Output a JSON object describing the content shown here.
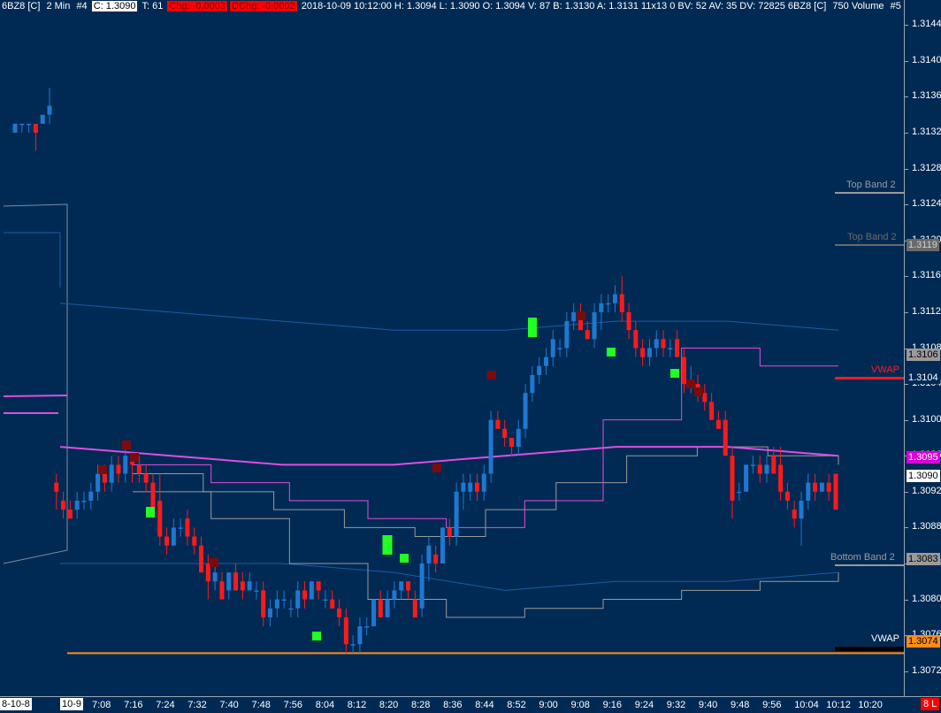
{
  "header": {
    "symbol": "6BZ8 [C]",
    "interval": "2 Min",
    "chart_no": "#4",
    "close": "C: 1.3090",
    "ticks": "T: 61",
    "chg": "Chg: -0.0003",
    "dchg": "DChg: -0.0002",
    "detail": "2018-10-09 10:12:00 H: 1.3094 L: 1.3090 O: 1.3094 V: 87 B: 1.3130 A: 1.3131 11x13 0 BV: 52 AV: 35 DV: 72825 6BZ8 [C]",
    "volume_label": "750 Volume",
    "volume_no": "#5"
  },
  "colors": {
    "background": "#002a54",
    "up_candle": "#1f78d0",
    "down_candle": "#ff1a1a",
    "green_marker": "#22ff22",
    "darkred_marker": "#7a0c0c",
    "vwap_line": "#e04de0",
    "band_gray": "#9a9a9a",
    "band_blue": "#1e5aa6",
    "support_line": "#ff8c1a",
    "vwap_tag": "#ff1a1a"
  },
  "tags": {
    "top_band_2a": "Top Band 2",
    "top_band_2b": "Top Band 2",
    "top_band_2b_value": "1.3119",
    "upper_value": "1.3106",
    "vwap_red_label": "VWAP",
    "vwap_red_value": "1.3104",
    "magenta_value": "1.3095",
    "last_value": "1.3090",
    "bottom_band_2": "Bottom Band 2",
    "bottom_band_2_value": "1.3083",
    "vwap_black_label": "VWAP",
    "vwap_black_value": "1.3074"
  },
  "time_axis": {
    "date_start": "8-10-8",
    "date_mid": "10-9",
    "corner_tag": "8 L"
  },
  "chart_data": {
    "type": "candlestick",
    "ylim": [
      1.307,
      1.3146
    ],
    "y_ticks": [
      "1.3072",
      "1.3076",
      "1.3080",
      "1.3084",
      "1.3088",
      "1.3092",
      "1.3096",
      "1.3100",
      "1.3104",
      "1.3108",
      "1.3112",
      "1.3116",
      "1.3120",
      "1.3124",
      "1.3128",
      "1.3132",
      "1.3136",
      "1.3140",
      "1.3144"
    ],
    "x_ticks": [
      "7:08",
      "7:16",
      "7:24",
      "7:32",
      "7:40",
      "7:48",
      "7:56",
      "8:04",
      "8:12",
      "8:20",
      "8:28",
      "8:36",
      "8:44",
      "8:52",
      "9:00",
      "9:08",
      "9:16",
      "9:24",
      "9:32",
      "9:40",
      "9:48",
      "9:56",
      "10:04",
      "10:12",
      "10:20"
    ],
    "candles": [
      {
        "o": 1.3132,
        "h": 1.3133,
        "l": 1.3132,
        "c": 1.3133
      },
      {
        "o": 1.3133,
        "h": 1.3133,
        "l": 1.3132,
        "c": 1.3133
      },
      {
        "o": 1.3133,
        "h": 1.3133,
        "l": 1.3132,
        "c": 1.3133
      },
      {
        "o": 1.3133,
        "h": 1.3133,
        "l": 1.313,
        "c": 1.3132
      },
      {
        "o": 1.3133,
        "h": 1.3134,
        "l": 1.3133,
        "c": 1.3134
      },
      {
        "o": 1.3134,
        "h": 1.3137,
        "l": 1.3133,
        "c": 1.3135
      },
      {
        "o": 1.3093,
        "h": 1.3094,
        "l": 1.309,
        "c": 1.3092
      },
      {
        "o": 1.3091,
        "h": 1.3092,
        "l": 1.3089,
        "c": 1.309
      },
      {
        "o": 1.309,
        "h": 1.3091,
        "l": 1.3089,
        "c": 1.3089
      },
      {
        "o": 1.309,
        "h": 1.3092,
        "l": 1.3089,
        "c": 1.3091
      },
      {
        "o": 1.3091,
        "h": 1.3092,
        "l": 1.309,
        "c": 1.3091
      },
      {
        "o": 1.3091,
        "h": 1.3093,
        "l": 1.309,
        "c": 1.3092
      },
      {
        "o": 1.3092,
        "h": 1.3095,
        "l": 1.3091,
        "c": 1.3094
      },
      {
        "o": 1.3094,
        "h": 1.3095,
        "l": 1.3092,
        "c": 1.3093
      },
      {
        "o": 1.3093,
        "h": 1.3096,
        "l": 1.3092,
        "c": 1.3095
      },
      {
        "o": 1.3095,
        "h": 1.3096,
        "l": 1.3093,
        "c": 1.3094
      },
      {
        "o": 1.3094,
        "h": 1.3097,
        "l": 1.3093,
        "c": 1.3096
      },
      {
        "o": 1.3096,
        "h": 1.3096,
        "l": 1.3093,
        "c": 1.3095
      },
      {
        "o": 1.3095,
        "h": 1.3096,
        "l": 1.3093,
        "c": 1.3094
      },
      {
        "o": 1.3094,
        "h": 1.3095,
        "l": 1.3092,
        "c": 1.3093
      },
      {
        "o": 1.3093,
        "h": 1.3094,
        "l": 1.3089,
        "c": 1.309
      },
      {
        "o": 1.3091,
        "h": 1.3094,
        "l": 1.3086,
        "c": 1.3087
      },
      {
        "o": 1.3087,
        "h": 1.3088,
        "l": 1.3085,
        "c": 1.3086
      },
      {
        "o": 1.3086,
        "h": 1.3089,
        "l": 1.3086,
        "c": 1.3088
      },
      {
        "o": 1.3088,
        "h": 1.3089,
        "l": 1.3087,
        "c": 1.3088
      },
      {
        "o": 1.3089,
        "h": 1.309,
        "l": 1.3086,
        "c": 1.3087
      },
      {
        "o": 1.3087,
        "h": 1.3088,
        "l": 1.3085,
        "c": 1.3086
      },
      {
        "o": 1.3086,
        "h": 1.3087,
        "l": 1.3083,
        "c": 1.3083
      },
      {
        "o": 1.3084,
        "h": 1.3085,
        "l": 1.308,
        "c": 1.3082
      },
      {
        "o": 1.3082,
        "h": 1.3084,
        "l": 1.3081,
        "c": 1.3083
      },
      {
        "o": 1.3082,
        "h": 1.3083,
        "l": 1.308,
        "c": 1.308
      },
      {
        "o": 1.3081,
        "h": 1.3083,
        "l": 1.308,
        "c": 1.3083
      },
      {
        "o": 1.3083,
        "h": 1.3084,
        "l": 1.3081,
        "c": 1.3081
      },
      {
        "o": 1.3082,
        "h": 1.3083,
        "l": 1.308,
        "c": 1.3081
      },
      {
        "o": 1.3081,
        "h": 1.3083,
        "l": 1.3081,
        "c": 1.3082
      },
      {
        "o": 1.3081,
        "h": 1.3082,
        "l": 1.308,
        "c": 1.3081
      },
      {
        "o": 1.3081,
        "h": 1.3082,
        "l": 1.3077,
        "c": 1.3078
      },
      {
        "o": 1.3078,
        "h": 1.308,
        "l": 1.3077,
        "c": 1.3079
      },
      {
        "o": 1.3079,
        "h": 1.3081,
        "l": 1.3078,
        "c": 1.308
      },
      {
        "o": 1.308,
        "h": 1.3081,
        "l": 1.3079,
        "c": 1.308
      },
      {
        "o": 1.3079,
        "h": 1.308,
        "l": 1.3078,
        "c": 1.3079
      },
      {
        "o": 1.3079,
        "h": 1.3082,
        "l": 1.3078,
        "c": 1.3081
      },
      {
        "o": 1.3081,
        "h": 1.3082,
        "l": 1.3079,
        "c": 1.308
      },
      {
        "o": 1.308,
        "h": 1.3082,
        "l": 1.308,
        "c": 1.3082
      },
      {
        "o": 1.3082,
        "h": 1.3082,
        "l": 1.308,
        "c": 1.3081
      },
      {
        "o": 1.308,
        "h": 1.3081,
        "l": 1.3079,
        "c": 1.308
      },
      {
        "o": 1.308,
        "h": 1.3081,
        "l": 1.3079,
        "c": 1.3079
      },
      {
        "o": 1.3079,
        "h": 1.308,
        "l": 1.3077,
        "c": 1.3078
      },
      {
        "o": 1.3078,
        "h": 1.3079,
        "l": 1.3074,
        "c": 1.3075
      },
      {
        "o": 1.3075,
        "h": 1.3076,
        "l": 1.3074,
        "c": 1.3075
      },
      {
        "o": 1.3075,
        "h": 1.3078,
        "l": 1.3074,
        "c": 1.3077
      },
      {
        "o": 1.3077,
        "h": 1.3078,
        "l": 1.3076,
        "c": 1.3077
      },
      {
        "o": 1.3077,
        "h": 1.308,
        "l": 1.3077,
        "c": 1.308
      },
      {
        "o": 1.308,
        "h": 1.3081,
        "l": 1.3078,
        "c": 1.3078
      },
      {
        "o": 1.3078,
        "h": 1.3081,
        "l": 1.3078,
        "c": 1.308
      },
      {
        "o": 1.308,
        "h": 1.3082,
        "l": 1.3079,
        "c": 1.3081
      },
      {
        "o": 1.3081,
        "h": 1.3082,
        "l": 1.308,
        "c": 1.3082
      },
      {
        "o": 1.3082,
        "h": 1.3082,
        "l": 1.308,
        "c": 1.3081
      },
      {
        "o": 1.308,
        "h": 1.3081,
        "l": 1.3078,
        "c": 1.3078
      },
      {
        "o": 1.3079,
        "h": 1.3085,
        "l": 1.3078,
        "c": 1.3084
      },
      {
        "o": 1.3084,
        "h": 1.3087,
        "l": 1.3082,
        "c": 1.3086
      },
      {
        "o": 1.3085,
        "h": 1.3086,
        "l": 1.3083,
        "c": 1.3084
      },
      {
        "o": 1.3084,
        "h": 1.3088,
        "l": 1.3084,
        "c": 1.3088
      },
      {
        "o": 1.3088,
        "h": 1.3089,
        "l": 1.3086,
        "c": 1.3087
      },
      {
        "o": 1.3087,
        "h": 1.3093,
        "l": 1.3086,
        "c": 1.3092
      },
      {
        "o": 1.3092,
        "h": 1.3094,
        "l": 1.309,
        "c": 1.3093
      },
      {
        "o": 1.3092,
        "h": 1.3094,
        "l": 1.3091,
        "c": 1.3093
      },
      {
        "o": 1.3093,
        "h": 1.3094,
        "l": 1.3091,
        "c": 1.3092
      },
      {
        "o": 1.3092,
        "h": 1.3095,
        "l": 1.3091,
        "c": 1.3094
      },
      {
        "o": 1.3094,
        "h": 1.3101,
        "l": 1.3093,
        "c": 1.31
      },
      {
        "o": 1.31,
        "h": 1.3101,
        "l": 1.3099,
        "c": 1.3099
      },
      {
        "o": 1.3099,
        "h": 1.31,
        "l": 1.3097,
        "c": 1.3098
      },
      {
        "o": 1.3098,
        "h": 1.3098,
        "l": 1.3096,
        "c": 1.3097
      },
      {
        "o": 1.3097,
        "h": 1.31,
        "l": 1.3096,
        "c": 1.3099
      },
      {
        "o": 1.3099,
        "h": 1.3104,
        "l": 1.3098,
        "c": 1.3103
      },
      {
        "o": 1.3103,
        "h": 1.3106,
        "l": 1.3102,
        "c": 1.3105
      },
      {
        "o": 1.3105,
        "h": 1.3107,
        "l": 1.3104,
        "c": 1.3106
      },
      {
        "o": 1.3106,
        "h": 1.3108,
        "l": 1.3105,
        "c": 1.3107
      },
      {
        "o": 1.3107,
        "h": 1.311,
        "l": 1.3106,
        "c": 1.3109
      },
      {
        "o": 1.3108,
        "h": 1.3109,
        "l": 1.3107,
        "c": 1.3108
      },
      {
        "o": 1.3108,
        "h": 1.3112,
        "l": 1.3107,
        "c": 1.3111
      },
      {
        "o": 1.3111,
        "h": 1.3113,
        "l": 1.311,
        "c": 1.3112
      },
      {
        "o": 1.3112,
        "h": 1.3113,
        "l": 1.311,
        "c": 1.311
      },
      {
        "o": 1.311,
        "h": 1.3111,
        "l": 1.3109,
        "c": 1.3109
      },
      {
        "o": 1.3109,
        "h": 1.3113,
        "l": 1.3108,
        "c": 1.3112
      },
      {
        "o": 1.3112,
        "h": 1.3114,
        "l": 1.311,
        "c": 1.3113
      },
      {
        "o": 1.3113,
        "h": 1.3114,
        "l": 1.3112,
        "c": 1.3113
      },
      {
        "o": 1.3113,
        "h": 1.3115,
        "l": 1.3112,
        "c": 1.3114
      },
      {
        "o": 1.3114,
        "h": 1.3116,
        "l": 1.3111,
        "c": 1.3112
      },
      {
        "o": 1.3112,
        "h": 1.3113,
        "l": 1.3109,
        "c": 1.311
      },
      {
        "o": 1.311,
        "h": 1.3111,
        "l": 1.3107,
        "c": 1.3108
      },
      {
        "o": 1.3108,
        "h": 1.3109,
        "l": 1.3106,
        "c": 1.3107
      },
      {
        "o": 1.3107,
        "h": 1.3109,
        "l": 1.3106,
        "c": 1.3108
      },
      {
        "o": 1.3108,
        "h": 1.311,
        "l": 1.3107,
        "c": 1.3109
      },
      {
        "o": 1.3109,
        "h": 1.311,
        "l": 1.3107,
        "c": 1.3108
      },
      {
        "o": 1.3108,
        "h": 1.3109,
        "l": 1.3107,
        "c": 1.3108
      },
      {
        "o": 1.3109,
        "h": 1.311,
        "l": 1.3107,
        "c": 1.3107
      },
      {
        "o": 1.3107,
        "h": 1.3108,
        "l": 1.3103,
        "c": 1.3104
      },
      {
        "o": 1.3104,
        "h": 1.3106,
        "l": 1.3103,
        "c": 1.3104
      },
      {
        "o": 1.3104,
        "h": 1.3105,
        "l": 1.3102,
        "c": 1.3103
      },
      {
        "o": 1.3103,
        "h": 1.3104,
        "l": 1.3101,
        "c": 1.3102
      },
      {
        "o": 1.3102,
        "h": 1.3103,
        "l": 1.31,
        "c": 1.31
      },
      {
        "o": 1.31,
        "h": 1.3101,
        "l": 1.3099,
        "c": 1.3099
      },
      {
        "o": 1.31,
        "h": 1.3101,
        "l": 1.3096,
        "c": 1.3096
      },
      {
        "o": 1.3096,
        "h": 1.3097,
        "l": 1.3089,
        "c": 1.3091
      },
      {
        "o": 1.3092,
        "h": 1.3093,
        "l": 1.3091,
        "c": 1.3092
      },
      {
        "o": 1.3092,
        "h": 1.3095,
        "l": 1.3092,
        "c": 1.3095
      },
      {
        "o": 1.3095,
        "h": 1.3096,
        "l": 1.3094,
        "c": 1.3095
      },
      {
        "o": 1.3095,
        "h": 1.3096,
        "l": 1.3093,
        "c": 1.3094
      },
      {
        "o": 1.3094,
        "h": 1.3096,
        "l": 1.3093,
        "c": 1.3095
      },
      {
        "o": 1.3096,
        "h": 1.3097,
        "l": 1.3094,
        "c": 1.3094
      },
      {
        "o": 1.3095,
        "h": 1.3097,
        "l": 1.3091,
        "c": 1.3092
      },
      {
        "o": 1.3092,
        "h": 1.3093,
        "l": 1.309,
        "c": 1.3091
      },
      {
        "o": 1.309,
        "h": 1.3091,
        "l": 1.3088,
        "c": 1.3089
      },
      {
        "o": 1.3089,
        "h": 1.3092,
        "l": 1.3086,
        "c": 1.3091
      },
      {
        "o": 1.3091,
        "h": 1.3094,
        "l": 1.309,
        "c": 1.3093
      },
      {
        "o": 1.3093,
        "h": 1.3094,
        "l": 1.3091,
        "c": 1.3092
      },
      {
        "o": 1.3092,
        "h": 1.3093,
        "l": 1.3092,
        "c": 1.3093
      },
      {
        "o": 1.3093,
        "h": 1.3094,
        "l": 1.3091,
        "c": 1.3092
      },
      {
        "o": 1.3094,
        "h": 1.3094,
        "l": 1.309,
        "c": 1.309
      }
    ],
    "vwap": [
      1.3097,
      1.3096,
      1.3095,
      1.3095,
      1.3096,
      1.3097,
      1.3097,
      1.3096
    ],
    "upper_band": [
      1.3094,
      1.3092,
      1.309,
      1.3088,
      1.3087,
      1.309,
      1.3093,
      1.3096,
      1.3097,
      1.3096,
      1.3095
    ],
    "lower_band": [
      1.3091,
      1.3088,
      1.3086,
      1.3084,
      1.3083,
      1.3086,
      1.3088,
      1.3092,
      1.3094,
      1.3096,
      1.3096
    ],
    "inner_upper": [
      1.3095,
      1.3093,
      1.3091,
      1.3089,
      1.3088,
      1.3091,
      1.31,
      1.3108,
      1.3106,
      1.3106
    ],
    "inner_lower": [
      1.3092,
      1.3089,
      1.3084,
      1.308,
      1.3078,
      1.3079,
      1.308,
      1.3081,
      1.3082,
      1.3083
    ],
    "outer_upper": [
      1.3113,
      1.3112,
      1.3111,
      1.311,
      1.311,
      1.3111,
      1.3111,
      1.311
    ],
    "outer_lower": [
      1.3084,
      1.3084,
      1.3084,
      1.3083,
      1.3081,
      1.3082,
      1.3082,
      1.3083
    ],
    "support_level": 1.3074
  }
}
